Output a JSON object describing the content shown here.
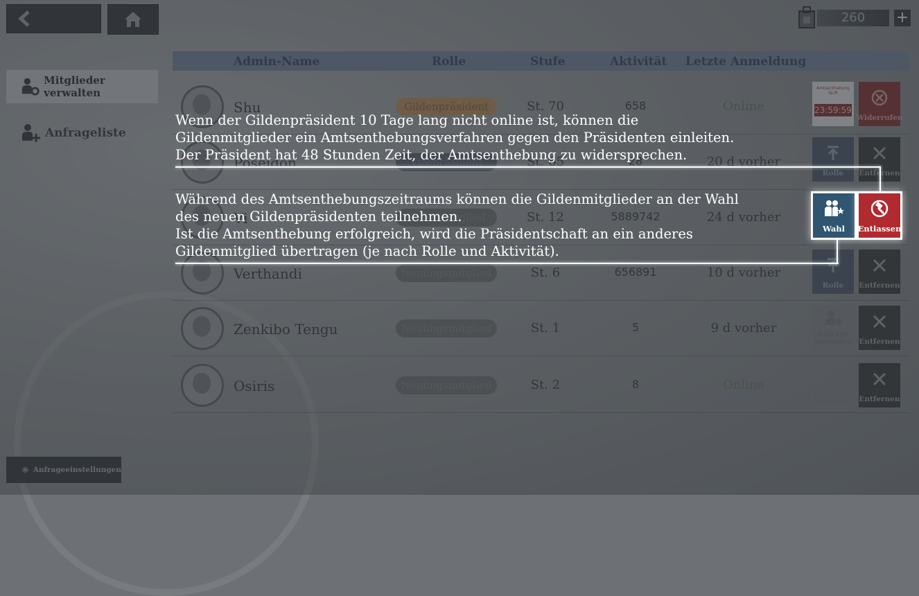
{
  "currency": {
    "amount": "260",
    "plus": "+",
    "icon": "bag-icon"
  },
  "sidebar": {
    "items": [
      {
        "label": "Mitglieder verwalten",
        "icon": "member-gear-icon",
        "active": true
      },
      {
        "label": "Anfrageliste",
        "icon": "member-add-icon",
        "active": false
      }
    ],
    "settings_label": "Anfrageeinstellungen"
  },
  "table": {
    "headers": [
      "Admin-Name",
      "Rolle",
      "Stufe",
      "Aktivität",
      "Letzte Anmeldung"
    ],
    "rows": [
      {
        "name": "Shu",
        "role": "Gildenpräsident",
        "level": "St. 70",
        "activity": "658",
        "last_login": "Online"
      },
      {
        "name": "Poseidon",
        "role": "Vizepräsident",
        "level": "St. 65",
        "activity": "28",
        "last_login": "20 d vorher"
      },
      {
        "name": "Vi",
        "role": "Gildenmitglied",
        "level": "St. 12",
        "activity": "5889742",
        "last_login": "24 d vorher"
      },
      {
        "name": "Verthandi",
        "role": "Neulingsmitglied",
        "level": "St. 6",
        "activity": "656891",
        "last_login": "10 d vorher"
      },
      {
        "name": "Zenkibo Tengu",
        "role": "Neulingsmitglied",
        "level": "St. 1",
        "activity": "5",
        "last_login": "9 d vorher"
      },
      {
        "name": "Osiris",
        "role": "Neulingsmitglied",
        "level": "St. 2",
        "activity": "8",
        "last_login": "Online"
      }
    ]
  },
  "actions": {
    "impeach_label": "Amtsenthebung läuft",
    "timer": "23:59:59",
    "revoke": "Widerrufen",
    "promote": "Rolle",
    "remove": "Entfernen",
    "request_sent": "Anfrage gesendet",
    "vote": "Wahl",
    "dismiss": "Entlassen"
  },
  "tutorial": {
    "p1_line1": "Wenn der Gildenpräsident 10 Tage lang nicht online ist, können die",
    "p1_line2": "Gildenmitglieder ein Amtsenthebungsverfahren gegen den Präsidenten einleiten.",
    "p1_line3": "Der Präsident hat 48 Stunden Zeit, der Amtsenthebung zu widersprechen.",
    "p2_line1": "Während des Amtsenthebungszeitraums können die Gildenmitglieder an der Wahl",
    "p2_line2": "des neuen Gildenpräsidenten teilnehmen.",
    "p2_line3": "Ist die Amtsenthebung erfolgreich, wird die Präsidentschaft an ein anderes",
    "p2_line4": "Gildenmitglied übertragen (je nach Rolle und Aktivität)."
  },
  "colors": {
    "highlight_vote": "#2f5570",
    "highlight_dismiss": "#b02a30",
    "header": "#6c7d8e"
  }
}
